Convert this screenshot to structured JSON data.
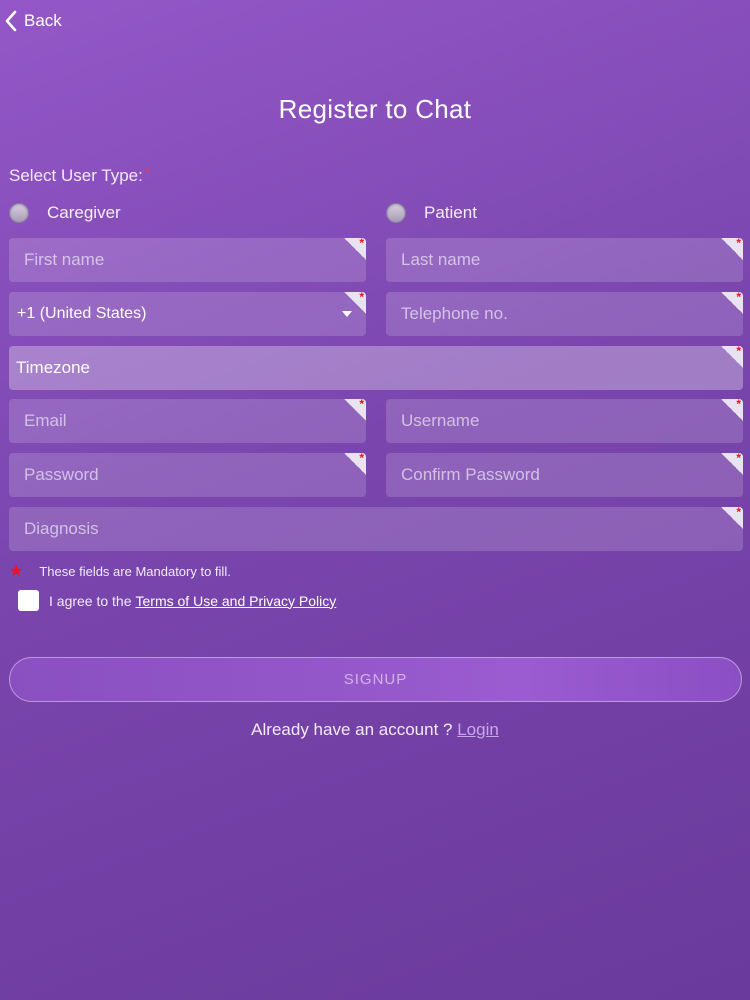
{
  "header": {
    "back_label": "Back",
    "title": "Register to Chat"
  },
  "user_type": {
    "label": "Select User Type:",
    "required_mark": "*",
    "options": [
      {
        "label": "Caregiver",
        "selected": false
      },
      {
        "label": "Patient",
        "selected": false
      }
    ]
  },
  "fields": {
    "first_name": {
      "placeholder": "First name",
      "value": ""
    },
    "last_name": {
      "placeholder": "Last name",
      "value": ""
    },
    "country_code": {
      "value": "+1 (United States)"
    },
    "telephone": {
      "placeholder": "Telephone no.",
      "value": ""
    },
    "timezone": {
      "placeholder": "Timezone",
      "value": ""
    },
    "email": {
      "placeholder": "Email",
      "value": ""
    },
    "username": {
      "placeholder": "Username",
      "value": ""
    },
    "password": {
      "placeholder": "Password",
      "value": ""
    },
    "confirm_password": {
      "placeholder": "Confirm Password",
      "value": ""
    },
    "diagnosis": {
      "placeholder": "Diagnosis",
      "value": ""
    }
  },
  "mandatory_note": "These fields are Mandatory to fill.",
  "agree": {
    "prefix": "I agree to the",
    "link": "Terms of Use and Privacy Policy",
    "checked": false
  },
  "signup_label": "SIGNUP",
  "login": {
    "prompt": "Already have an account ?",
    "link": "Login"
  },
  "colors": {
    "background_start": "#9457c7",
    "background_end": "#6a3a9c",
    "required_star": "#e8141f"
  }
}
